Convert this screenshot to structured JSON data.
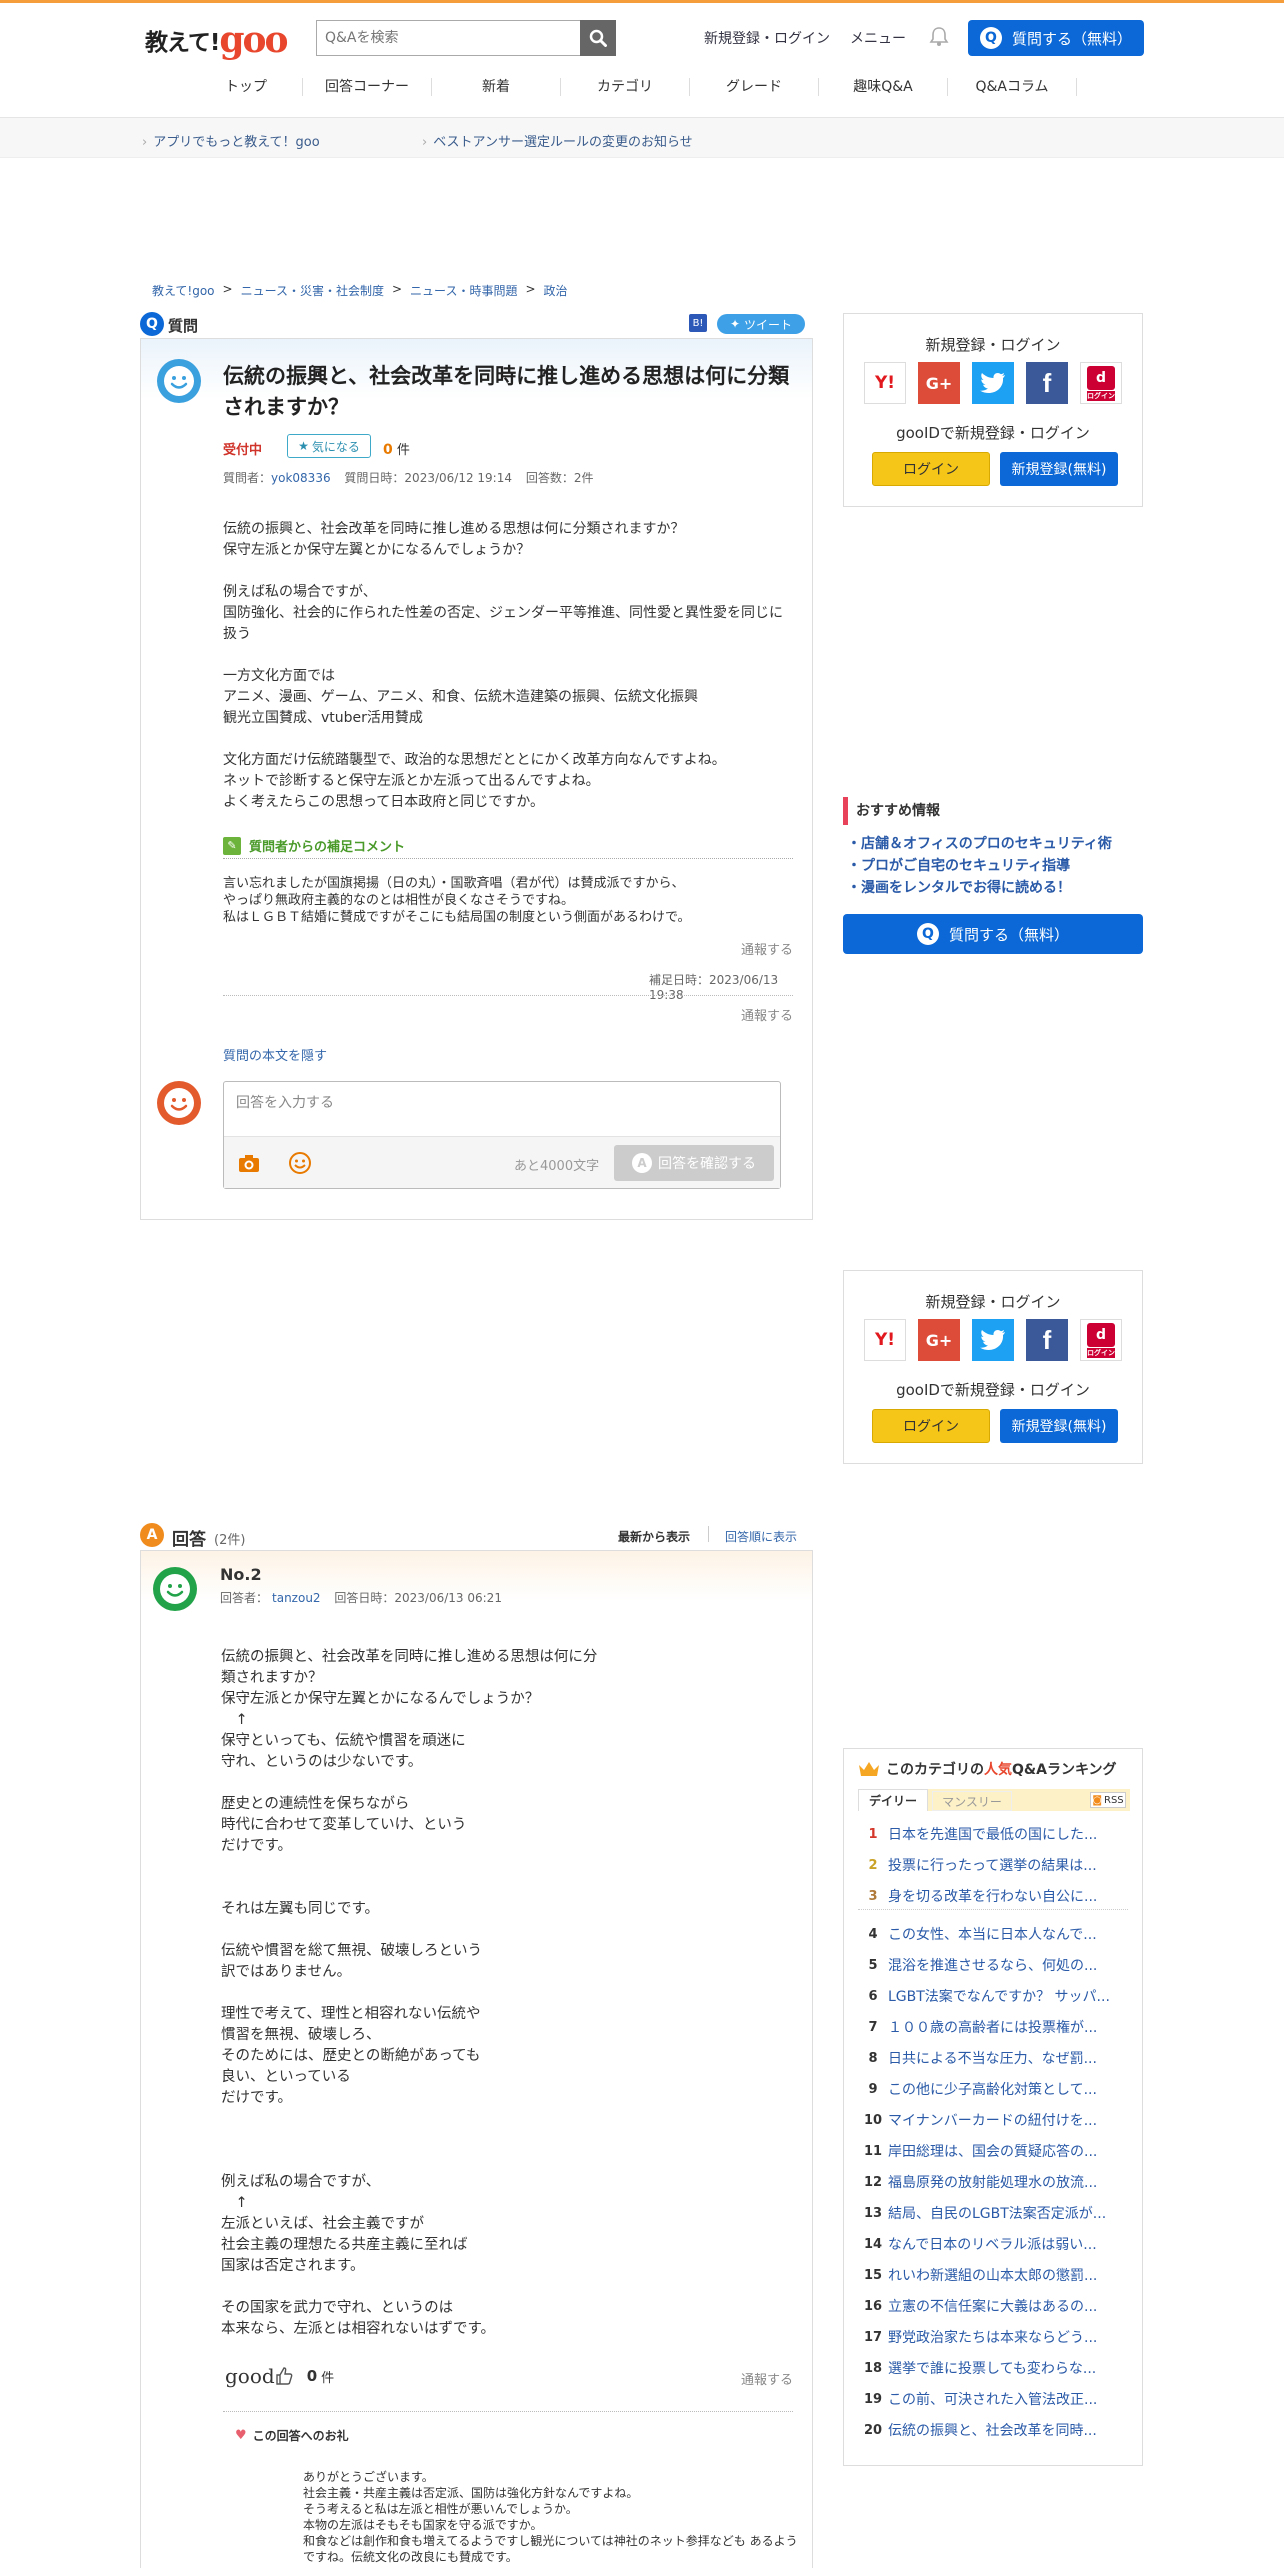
{
  "header": {
    "logo_text": "教えて!",
    "logo_goo": "goo",
    "search_placeholder": "Q&Aを検索",
    "signup_login": "新規登録・ログイン",
    "menu": "メニュー",
    "ask_button": "質問する（無料）"
  },
  "nav": [
    "トップ",
    "回答コーナー",
    "新着",
    "カテゴリ",
    "グレード",
    "趣味Q&A",
    "Q&Aコラム"
  ],
  "news": [
    "アプリでもっと教えて！goo",
    "ベストアンサー選定ルールの変更のお知らせ"
  ],
  "breadcrumb": [
    "教えて!goo",
    "ニュース・災害・社会制度",
    "ニュース・時事問題",
    "政治"
  ],
  "question": {
    "section_label": "質問",
    "tweet": "ツイート",
    "title": "伝統の振興と、社会改革を同時に推し進める思想は何に分類されますか？",
    "status": "受付中",
    "fav_label": "気になる",
    "fav_count": "0",
    "fav_unit": "件",
    "meta_asker_label": "質問者：",
    "asker": "yok08336",
    "meta_date": "質問日時：2023/06/12 19:14",
    "meta_answers": "回答数：2件",
    "body": "伝統の振興と、社会改革を同時に推し進める思想は何に分類されますか？\n保守左派とか保守左翼とかになるんでしょうか？\n\n例えば私の場合ですが、\n国防強化、社会的に作られた性差の否定、ジェンダー平等推進、同性愛と異性愛を同じに扱う\n\n一方文化方面では\nアニメ、漫画、ゲーム、アニメ、和食、伝統木造建築の振興、伝統文化振興\n観光立国賛成、vtuber活用賛成\n\n文化方面だけ伝統踏襲型で、政治的な思想だととにかく改革方向なんですよね。\nネットで診断すると保守左派とか左派って出るんですよね。\nよく考えたらこの思想って日本政府と同じですか。",
    "supplement_label": "質問者からの補足コメント",
    "supplement_body": "言い忘れましたが国旗掲揚（日の丸）・国歌斉唱（君が代）は賛成派ですから、\nやっぱり無政府主義的なのとは相性が良くなさそうですね。\n私はＬＧＢＴ結婚に賛成ですがそこにも結局国の制度という側面があるわけで。",
    "report": "通報する",
    "supplement_date": "補足日時：2023/06/13 19:38",
    "hide_body": "質問の本文を隠す",
    "answer_placeholder": "回答を入力する",
    "char_left": "あと4000文字",
    "confirm_button": "回答を確認する"
  },
  "login_box": {
    "title": "新規登録・ログイン",
    "goo_id": "gooIDで新規登録・ログイン",
    "login": "ログイン",
    "register": "新規登録(無料)",
    "yahoo": "Y!",
    "google": "G+",
    "docomo": "ログイン"
  },
  "recommend": {
    "title": "おすすめ情報",
    "items": [
      "店舗＆オフィスのプロのセキュリティ術",
      "プロがご自宅のセキュリティ指導",
      "漫画をレンタルでお得に読める！"
    ]
  },
  "answers": {
    "section_label": "回答",
    "count": "(2件)",
    "sort_newest": "最新から表示",
    "sort_order": "回答順に表示",
    "no": "No.2",
    "answerer_label": "回答者：",
    "answerer": "tanzou2",
    "date": "回答日時：2023/06/13 06:21",
    "body": "伝統の振興と、社会改革を同時に推し進める思想は何に分\n類されますか？\n保守左派とか保守左翼とかになるんでしょうか？\n　↑\n保守といっても、伝統や慣習を頑迷に\n守れ、というのは少ないです。\n\n歴史との連続性を保ちながら\n時代に合わせて変革していけ、という\nだけです。\n\n\nそれは左翼も同じです。\n\n伝統や慣習を総て無視、破壊しろという\n訳ではありません。\n\n理性で考えて、理性と相容れない伝統や\n慣習を無視、破壊しろ、\nそのためには、歴史との断絶があっても\n良い、といっている\nだけです。\n\n\n\n例えば私の場合ですが、\n　↑\n左派といえば、社会主義ですが\n社会主義の理想たる共産主義に至れば\n国家は否定されます。\n\nその国家を武力で守れ、というのは\n本来なら、左派とは相容れないはずです。",
    "good_label": "good",
    "good_count": "0",
    "good_unit": "件",
    "report": "通報する",
    "thanks_label": "この回答へのお礼",
    "thanks_body": "ありがとうございます。\n社会主義・共産主義は否定派、国防は強化方針なんですよね。\nそう考えると私は左派と相性が悪いんでしょうか。\n本物の左派はそもそも国家を守る派ですか。\n和食などは創作和食も増えてるようですし観光については神社のネット参拝なども あるようですね。伝統文化の改良にも賛成です。"
  },
  "ranking": {
    "title_pre": "このカテゴリの",
    "title_hot": "人気",
    "title_post": "Q&Aランキング",
    "tab_daily": "デイリー",
    "tab_monthly": "マンスリー",
    "rss": "RSS",
    "items": [
      "日本を先進国で最低の国にした...",
      "投票に行ったって選挙の結果は...",
      "身を切る改革を行わない自公に...",
      "この女性、本当に日本人なんで...",
      "混浴を推進させるなら、何処の...",
      "LGBT法案でなんですか？ サッパ...",
      "１００歳の高齢者には投票権が...",
      "日共による不当な圧力、なぜ罰...",
      "この他に少子高齢化対策として...",
      "マイナンバーカードの紐付けを...",
      "岸田総理は、国会の質疑応答の...",
      "福島原発の放射能処理水の放流...",
      "結局、自民のLGBT法案否定派が...",
      "なんで日本のリベラル派は弱い...",
      "れいわ新選組の山本太郎の懲罰...",
      "立憲の不信任案に大義はあるの...",
      "野党政治家たちは本来ならどう...",
      "選挙で誰に投票しても変わらな...",
      "この前、可決された入管法改正...",
      "伝統の振興と、社会改革を同時..."
    ],
    "numbers": [
      "1",
      "2",
      "3",
      "4",
      "5",
      "6",
      "7",
      "8",
      "9",
      "10",
      "11",
      "12",
      "13",
      "14",
      "15",
      "16",
      "17",
      "18",
      "19",
      "20"
    ]
  }
}
